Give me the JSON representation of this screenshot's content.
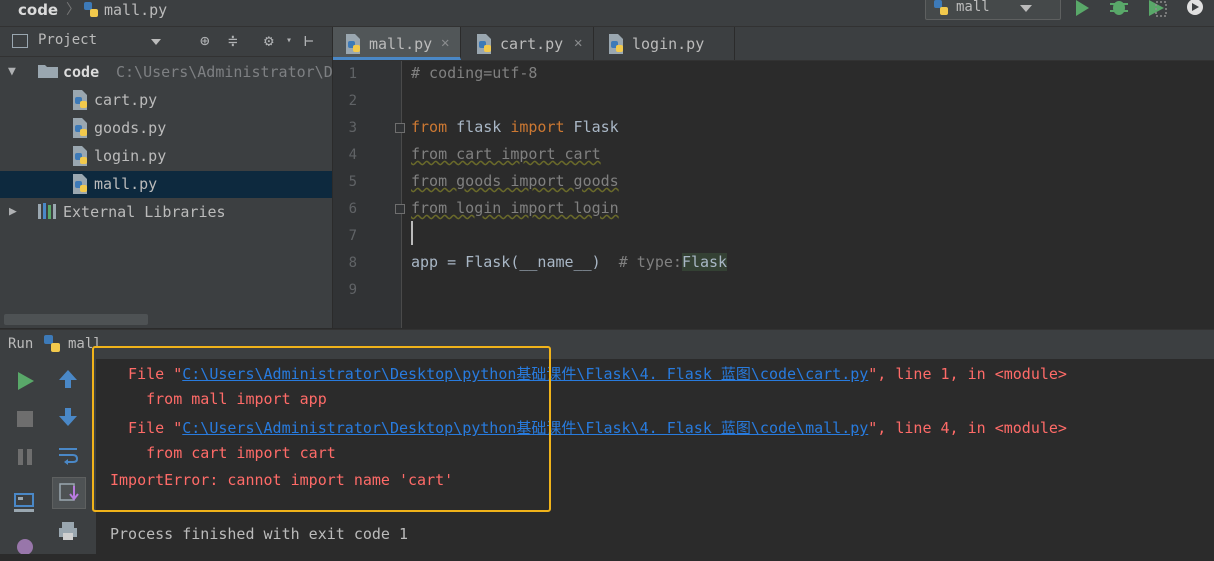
{
  "navbar": {
    "root": "code",
    "separator": "〉",
    "file": "mall.py"
  },
  "run_config": {
    "label": "mall"
  },
  "project": {
    "header_label": "Project",
    "root_name": "code",
    "root_path": "C:\\Users\\Administrator\\D",
    "files": [
      "cart.py",
      "goods.py",
      "login.py",
      "mall.py"
    ],
    "external": "External Libraries"
  },
  "tabs": [
    {
      "label": "mall.py",
      "close": "✕"
    },
    {
      "label": "cart.py",
      "close": "✕"
    },
    {
      "label": "login.py",
      "close": ""
    }
  ],
  "editor": {
    "line_numbers": [
      "1",
      "2",
      "3",
      "4",
      "5",
      "6",
      "7",
      "8",
      "9"
    ],
    "l1": "# coding=utf-8",
    "l3_kw1": "from",
    "l3_mod": " flask ",
    "l3_kw2": "import",
    "l3_name": " Flask",
    "l4": "from cart import cart",
    "l5": "from goods import goods",
    "l6": "from login import login",
    "l8_code": "app = Flask(__name__)  ",
    "l8_hint": "# type:",
    "l8_type": "Flask"
  },
  "run": {
    "label": "Run",
    "tab": "mall"
  },
  "console": {
    "l1_pre": "  File \"",
    "l1_path": "C:\\Users\\Administrator\\Desktop\\python基础课件\\Flask\\4. Flask 蓝图\\code\\cart.py",
    "l1_post": "\", line 1, in <module>",
    "l2": "    from mall import app",
    "l3_pre": "  File \"",
    "l3_path": "C:\\Users\\Administrator\\Desktop\\python基础课件\\Flask\\4. Flask 蓝图\\code\\mall.py",
    "l3_post": "\", line 4, in <module>",
    "l4": "    from cart import cart",
    "l5": "ImportError: cannot import name 'cart'",
    "l6": "Process finished with exit code 1"
  },
  "colors": {
    "accent_box": "#f0b31a",
    "error": "#ff6b68",
    "link": "#287bde",
    "keyword": "#cc7832"
  }
}
